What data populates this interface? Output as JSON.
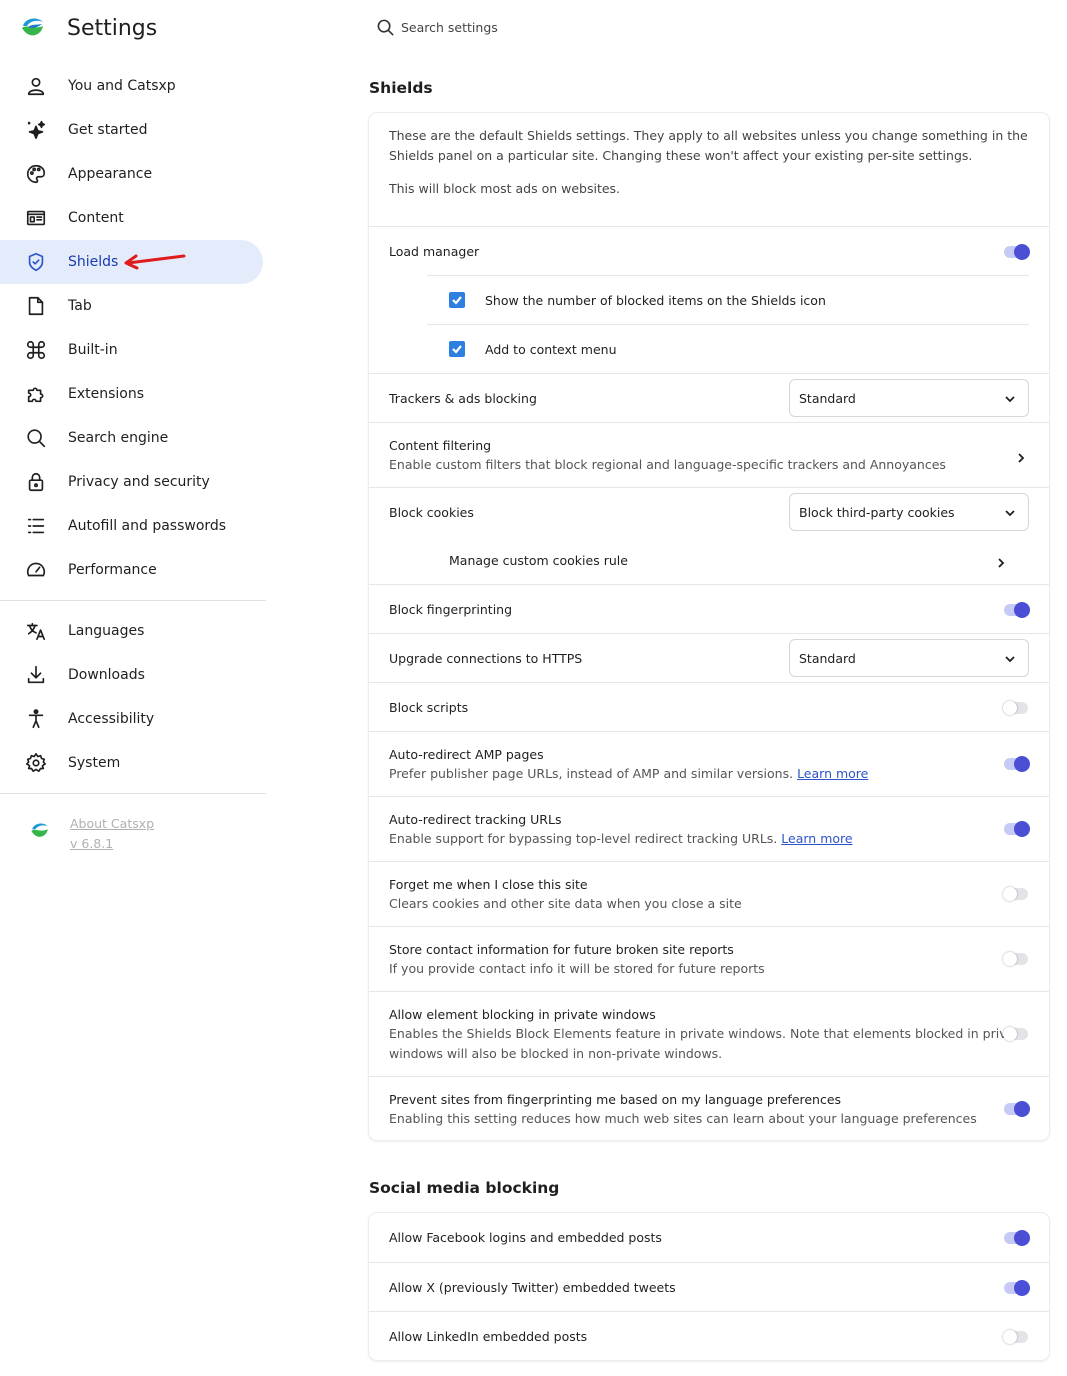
{
  "app": {
    "title": "Settings"
  },
  "search": {
    "placeholder": "Search settings"
  },
  "sidebar": {
    "items": [
      {
        "label": "You and Catsxp",
        "icon": "person-icon"
      },
      {
        "label": "Get started",
        "icon": "sparkle-star-icon"
      },
      {
        "label": "Appearance",
        "icon": "palette-icon"
      },
      {
        "label": "Content",
        "icon": "content-layout-icon"
      },
      {
        "label": "Shields",
        "icon": "shield-icon",
        "active": true
      },
      {
        "label": "Tab",
        "icon": "document-icon"
      },
      {
        "label": "Built-in",
        "icon": "command-icon"
      },
      {
        "label": "Extensions",
        "icon": "puzzle-icon"
      },
      {
        "label": "Search engine",
        "icon": "search-icon"
      },
      {
        "label": "Privacy and security",
        "icon": "lock-icon"
      },
      {
        "label": "Autofill and passwords",
        "icon": "list-icon"
      },
      {
        "label": "Performance",
        "icon": "gauge-icon"
      }
    ],
    "items2": [
      {
        "label": "Languages",
        "icon": "translate-icon"
      },
      {
        "label": "Downloads",
        "icon": "download-icon"
      },
      {
        "label": "Accessibility",
        "icon": "accessibility-icon"
      },
      {
        "label": "System",
        "icon": "gear-icon"
      }
    ],
    "about": {
      "label": "About Catsxp",
      "version": "v 6.8.1"
    }
  },
  "shields": {
    "title": "Shields",
    "intro": "These are the default Shields settings. They apply to all websites unless you change something in the Shields panel on a particular site. Changing these won't affect your existing per-site settings.",
    "intro2": "This will block most ads on websites.",
    "load_manager": {
      "label": "Load manager",
      "on": true
    },
    "show_count": {
      "label": "Show the number of blocked items on the Shields icon",
      "checked": true
    },
    "context_menu": {
      "label": "Add to context menu",
      "checked": true
    },
    "trackers": {
      "label": "Trackers & ads blocking",
      "value": "Standard"
    },
    "content_filtering": {
      "label": "Content filtering",
      "sub": "Enable custom filters that block regional and language-specific trackers and Annoyances"
    },
    "block_cookies": {
      "label": "Block cookies",
      "value": "Block third-party cookies"
    },
    "manage_cookies": {
      "label": "Manage custom cookies rule"
    },
    "fingerprinting": {
      "label": "Block fingerprinting",
      "on": true
    },
    "https": {
      "label": "Upgrade connections to HTTPS",
      "value": "Standard"
    },
    "scripts": {
      "label": "Block scripts",
      "on": false
    },
    "amp": {
      "label": "Auto-redirect AMP pages",
      "sub": "Prefer publisher page URLs, instead of AMP and similar versions.",
      "link": "Learn more",
      "on": true
    },
    "tracking_urls": {
      "label": "Auto-redirect tracking URLs",
      "sub": "Enable support for bypassing top-level redirect tracking URLs.",
      "link": "Learn more",
      "on": true
    },
    "forget_me": {
      "label": "Forget me when I close this site",
      "sub": "Clears cookies and other site data when you close a site",
      "on": false
    },
    "store_contact": {
      "label": "Store contact information for future broken site reports",
      "sub": "If you provide contact info it will be stored for future reports",
      "on": false
    },
    "element_blocking": {
      "label": "Allow element blocking in private windows",
      "sub1": "Enables the Shields Block Elements feature in private windows. Note that elements blocked in private",
      "sub2": "windows will also be blocked in non-private windows.",
      "on": false
    },
    "language_fp": {
      "label": "Prevent sites from fingerprinting me based on my language preferences",
      "sub": "Enabling this setting reduces how much web sites can learn about your language preferences",
      "on": true
    }
  },
  "social": {
    "title": "Social media blocking",
    "facebook": {
      "label": "Allow Facebook logins and embedded posts",
      "on": true
    },
    "twitter": {
      "label": "Allow X (previously Twitter) embedded tweets",
      "on": true
    },
    "linkedin": {
      "label": "Allow LinkedIn embedded posts",
      "on": false
    }
  },
  "colors": {
    "accent": "#4a4fd6",
    "active_nav_bg": "#e4ecfb",
    "annotation_arrow": "#e01b1b"
  }
}
